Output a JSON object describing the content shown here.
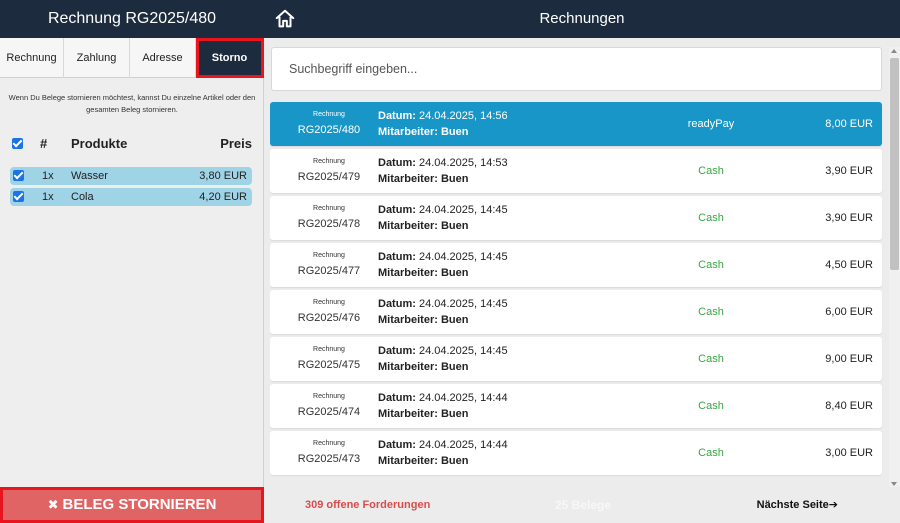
{
  "header": {
    "left_title": "Rechnung RG2025/480",
    "right_title": "Rechnungen",
    "home_icon": "home-icon"
  },
  "left": {
    "tabs": [
      {
        "label": "Rechnung"
      },
      {
        "label": "Zahlung"
      },
      {
        "label": "Adresse"
      },
      {
        "label": "Storno",
        "active": true
      }
    ],
    "info_text": "Wenn Du Belege stornieren möchtest, kannst Du einzelne Artikel oder den gesamten Beleg stornieren.",
    "columns": {
      "hash": "#",
      "product": "Produkte",
      "price": "Preis"
    },
    "products": [
      {
        "qty": "1x",
        "name": "Wasser",
        "price": "3,80 EUR",
        "checked": true
      },
      {
        "qty": "1x",
        "name": "Cola",
        "price": "4,20 EUR",
        "checked": true
      }
    ],
    "storno_button": "BELEG STORNIEREN",
    "storno_icon": "x-icon"
  },
  "right": {
    "search_placeholder": "Suchbegriff eingeben...",
    "date_label": "Datum:",
    "employee_label": "Mitarbeiter:",
    "invoices": [
      {
        "kind": "Rechnung",
        "number": "RG2025/480",
        "date": "24.04.2025, 14:56",
        "employee": "Buen",
        "payment": "readyPay",
        "amount": "8,00 EUR",
        "selected": true
      },
      {
        "kind": "Rechnung",
        "number": "RG2025/479",
        "date": "24.04.2025, 14:53",
        "employee": "Buen",
        "payment": "Cash",
        "amount": "3,90 EUR"
      },
      {
        "kind": "Rechnung",
        "number": "RG2025/478",
        "date": "24.04.2025, 14:45",
        "employee": "Buen",
        "payment": "Cash",
        "amount": "3,90 EUR"
      },
      {
        "kind": "Rechnung",
        "number": "RG2025/477",
        "date": "24.04.2025, 14:45",
        "employee": "Buen",
        "payment": "Cash",
        "amount": "4,50 EUR"
      },
      {
        "kind": "Rechnung",
        "number": "RG2025/476",
        "date": "24.04.2025, 14:45",
        "employee": "Buen",
        "payment": "Cash",
        "amount": "6,00 EUR"
      },
      {
        "kind": "Rechnung",
        "number": "RG2025/475",
        "date": "24.04.2025, 14:45",
        "employee": "Buen",
        "payment": "Cash",
        "amount": "9,00 EUR"
      },
      {
        "kind": "Rechnung",
        "number": "RG2025/474",
        "date": "24.04.2025, 14:44",
        "employee": "Buen",
        "payment": "Cash",
        "amount": "8,40 EUR"
      },
      {
        "kind": "Rechnung",
        "number": "RG2025/473",
        "date": "24.04.2025, 14:44",
        "employee": "Buen",
        "payment": "Cash",
        "amount": "3,00 EUR"
      }
    ],
    "footer": {
      "open_claims": "309 offene Forderungen",
      "count": "25 Belege",
      "next_page": "Nächste Seite"
    }
  },
  "colors": {
    "header_bg": "#1c2b3d",
    "selected_row": "#1896c7",
    "product_row": "#9fd3e6",
    "storno_button": "#e06464",
    "cash_green": "#3aa642",
    "open_claims_red": "#d84d4d",
    "highlight_outline": "#e8141e"
  }
}
